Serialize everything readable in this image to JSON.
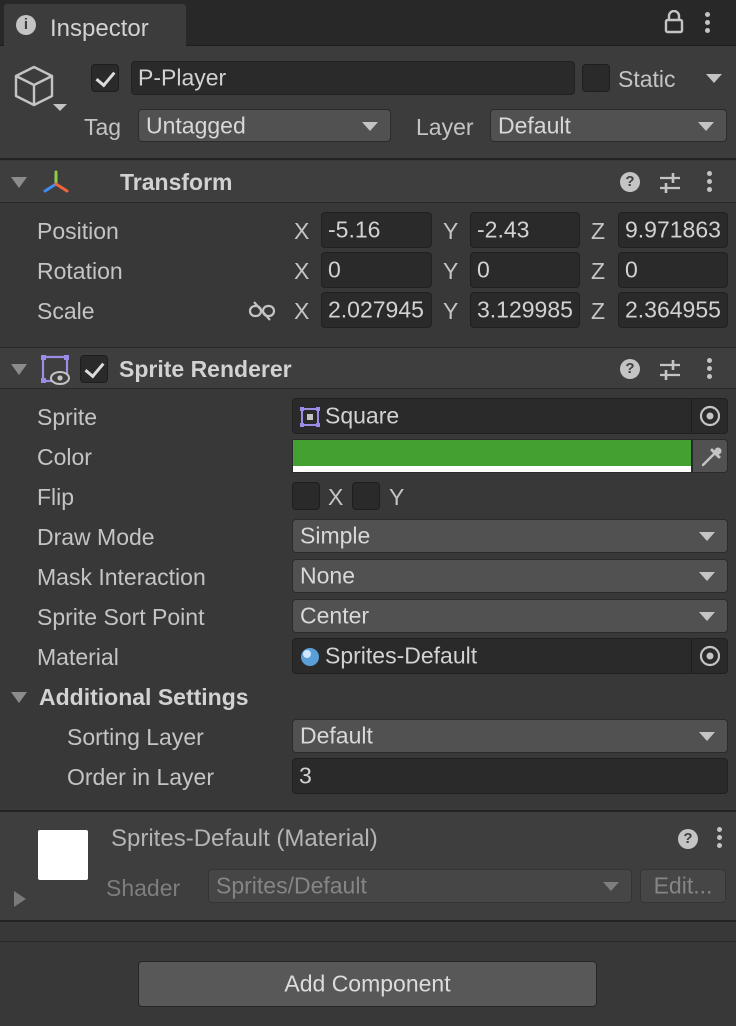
{
  "tab": {
    "title": "Inspector",
    "info_icon": "info-icon",
    "lock_icon": "lock-icon",
    "menu_icon": "vertical-dots-icon"
  },
  "header": {
    "object_icon": "cube-icon",
    "active_checked": true,
    "name": "P-Player",
    "static_label": "Static",
    "static_checked": false,
    "tag_label": "Tag",
    "tag_value": "Untagged",
    "layer_label": "Layer",
    "layer_value": "Default"
  },
  "transform": {
    "title": "Transform",
    "icon": "transform-icon",
    "rows": [
      {
        "label": "Position",
        "x": "-5.16",
        "y": "-2.43",
        "z": "9.971863"
      },
      {
        "label": "Rotation",
        "x": "0",
        "y": "0",
        "z": "0"
      },
      {
        "label": "Scale",
        "x": "2.027945",
        "y": "3.129985",
        "z": "2.364955"
      }
    ],
    "axes": {
      "x": "X",
      "y": "Y",
      "z": "Z"
    },
    "scale_link_icon": "unlink-icon"
  },
  "sprite_renderer": {
    "title": "Sprite Renderer",
    "enabled": true,
    "icon": "sprite-renderer-icon",
    "sprite_label": "Sprite",
    "sprite_value": "Square",
    "color_label": "Color",
    "color_value": "#44a031",
    "flip_label": "Flip",
    "flip_x": "X",
    "flip_y": "Y",
    "draw_mode_label": "Draw Mode",
    "draw_mode_value": "Simple",
    "mask_label": "Mask Interaction",
    "mask_value": "None",
    "sort_point_label": "Sprite Sort Point",
    "sort_point_value": "Center",
    "material_label": "Material",
    "material_value": "Sprites-Default",
    "additional_settings": "Additional Settings",
    "sorting_layer_label": "Sorting Layer",
    "sorting_layer_value": "Default",
    "order_label": "Order in Layer",
    "order_value": "3"
  },
  "material": {
    "title": "Sprites-Default (Material)",
    "shader_label": "Shader",
    "shader_value": "Sprites/Default",
    "edit_label": "Edit..."
  },
  "add_component": "Add Component"
}
